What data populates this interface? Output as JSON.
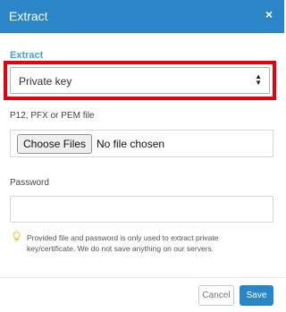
{
  "dialog": {
    "title": "Extract",
    "close_label": "×"
  },
  "form": {
    "extract_label": "Extract",
    "extract_selected": "Private key",
    "file_label": "P12, PFX or PEM file",
    "file_button_label": "Choose Files",
    "file_status": "No file chosen",
    "password_label": "Password",
    "password_value": "",
    "hint_text": "Provided file and password is only used to extract private key/certificate. We do not save anything on our servers."
  },
  "footer": {
    "cancel_label": "Cancel",
    "save_label": "Save"
  },
  "colors": {
    "header": "#2a86c6",
    "accent_label": "#4a9fd8",
    "highlight_border": "#e8000b",
    "hint_icon": "#f0c419"
  },
  "icons": {
    "close": "close-icon",
    "select_arrows": "chevron-up-down-icon",
    "hint": "lightbulb-icon"
  }
}
